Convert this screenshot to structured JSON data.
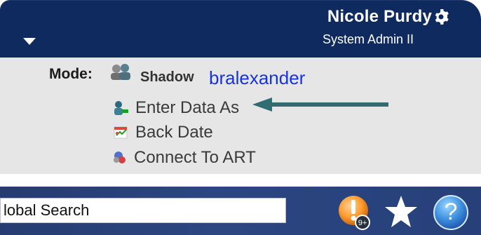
{
  "header": {
    "user_name": "Nicole Purdy",
    "user_role": "System Admin II"
  },
  "mode_panel": {
    "mode_label": "Mode:",
    "shadow": {
      "label": "Shadow",
      "user": "bralexander"
    },
    "items": [
      {
        "label": "Enter Data As",
        "icon": "enter-data-icon"
      },
      {
        "label": "Back Date",
        "icon": "calendar-icon"
      },
      {
        "label": "Connect To ART",
        "icon": "connect-icon"
      }
    ]
  },
  "toolbar": {
    "search_value": "lobal Search",
    "alerts_badge": "9+",
    "accent_color": "#0f2a5f",
    "annotation_arrow_color": "#2f6d73"
  }
}
